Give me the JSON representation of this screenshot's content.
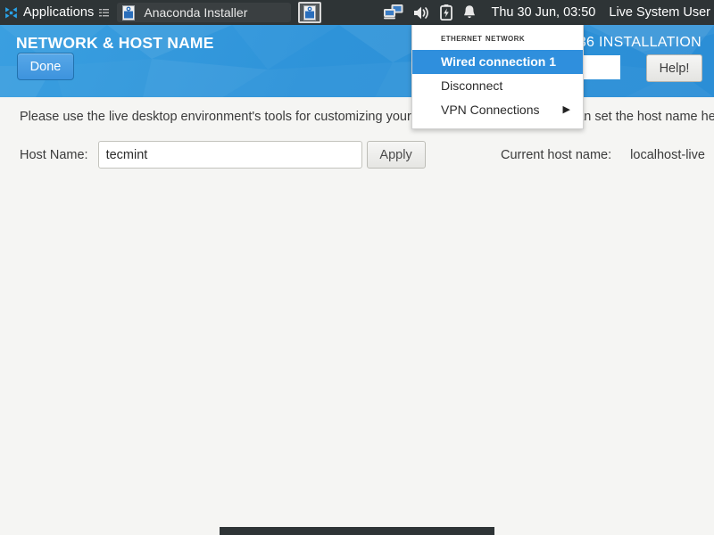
{
  "topbar": {
    "apps_icon": "applications-grid-icon",
    "apps_label": "Applications",
    "list_icon": "window-list-icon",
    "task_button": {
      "icon": "anaconda-installer-icon",
      "label": "Anaconda Installer"
    },
    "icon_button": {
      "icon": "anaconda-installer-icon"
    },
    "tray": [
      {
        "icon": "network-wired-icon",
        "name": "network-icon"
      },
      {
        "icon": "volume-icon",
        "name": "volume-icon"
      },
      {
        "icon": "battery-icon",
        "name": "battery-icon"
      },
      {
        "icon": "bell-icon",
        "name": "notifications-icon"
      }
    ],
    "clock": "Thu 30 Jun, 03:50",
    "user": "Live System User"
  },
  "hub": {
    "title": "NETWORK & HOST NAME",
    "done_label": "Done",
    "distro_label": "36 INSTALLATION",
    "search_value": "",
    "search_placeholder": "",
    "help_label": "Help!"
  },
  "content": {
    "description": "Please use the live desktop environment's tools for customizing your network configuration.  You can set the host name here.",
    "host_name_label": "Host Name:",
    "host_name_value": "tecmint",
    "host_name_placeholder": "",
    "apply_label": "Apply",
    "current_host_label": "Current host name:",
    "current_host_value": "localhost-live"
  },
  "network_menu": {
    "header": "Ethernet Network",
    "items": [
      {
        "label": "Wired connection 1",
        "selected": true,
        "submenu": false
      },
      {
        "label": "Disconnect",
        "selected": false,
        "submenu": false
      },
      {
        "label": "VPN Connections",
        "selected": false,
        "submenu": true
      }
    ],
    "submenu_arrow": "▶"
  },
  "colors": {
    "panel_bg": "#2e3436",
    "header_blue": "#2e93d9",
    "accent_blue": "#2f8fdd",
    "content_bg": "#f5f5f3"
  }
}
